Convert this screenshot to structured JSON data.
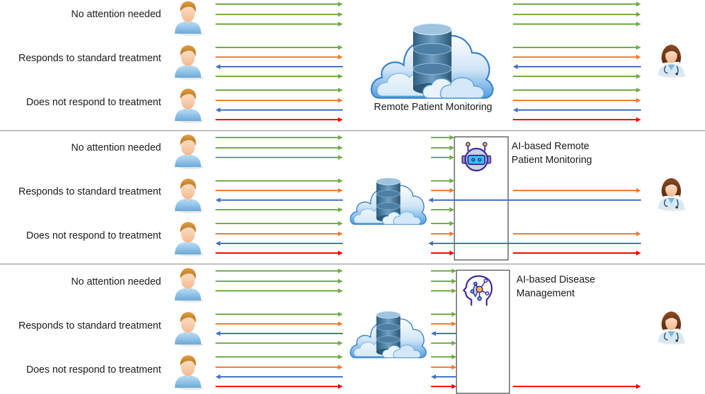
{
  "colors": {
    "green": "#70ad47",
    "orange": "#ed7d31",
    "blue": "#4472c4",
    "red": "#ff0000",
    "divider": "#808080",
    "box_border": "#404040",
    "icon_purple": "#3b2a9c",
    "icon_cyan": "#34c3f0",
    "icon_gold": "#f5b949",
    "icon_grey": "#c8d3e0"
  },
  "patient_groups": [
    {
      "label": "No attention needed",
      "signals": [
        "green-right",
        "green-right",
        "green-right"
      ]
    },
    {
      "label": "Responds to standard treatment",
      "signals": [
        "green-right",
        "orange-right",
        "blue-left",
        "green-right"
      ]
    },
    {
      "label": "Does not respond to treatment",
      "signals": [
        "green-right",
        "orange-right",
        "blue-left",
        "red-right"
      ]
    }
  ],
  "panels": [
    {
      "id": "rpm",
      "hub_label": "Remote Patient Monitoring",
      "hub_icon": "cloud-database-icon",
      "ai_box": null,
      "clinician_signals": [
        [
          "green-right",
          "green-right",
          "green-right"
        ],
        [
          "green-right",
          "orange-right",
          "blue-left",
          "green-right"
        ],
        [
          "green-right",
          "orange-right",
          "blue-left",
          "red-right"
        ]
      ]
    },
    {
      "id": "ai-rpm",
      "hub_label": "",
      "hub_icon": "cloud-database-icon",
      "ai_box": {
        "label_line1": "AI-based Remote",
        "label_line2": "Patient Monitoring",
        "icon": "robot-icon"
      },
      "clinician_signals": [
        [
          null,
          null,
          null
        ],
        [
          null,
          "orange-right",
          "blue-left-long",
          null
        ],
        [
          null,
          "orange-right",
          "blue-left-long",
          "red-right"
        ]
      ]
    },
    {
      "id": "ai-dm",
      "hub_label": "",
      "hub_icon": "cloud-database-icon",
      "ai_box": {
        "label_line1": "AI-based Disease",
        "label_line2": "Management",
        "icon": "brain-network-icon"
      },
      "clinician_signals": [
        [
          null,
          null,
          null
        ],
        [
          null,
          null,
          null,
          null
        ],
        [
          null,
          null,
          null,
          "red-right"
        ]
      ]
    }
  ],
  "clinician_icon": "doctor-icon",
  "patient_icon": "patient-icon"
}
